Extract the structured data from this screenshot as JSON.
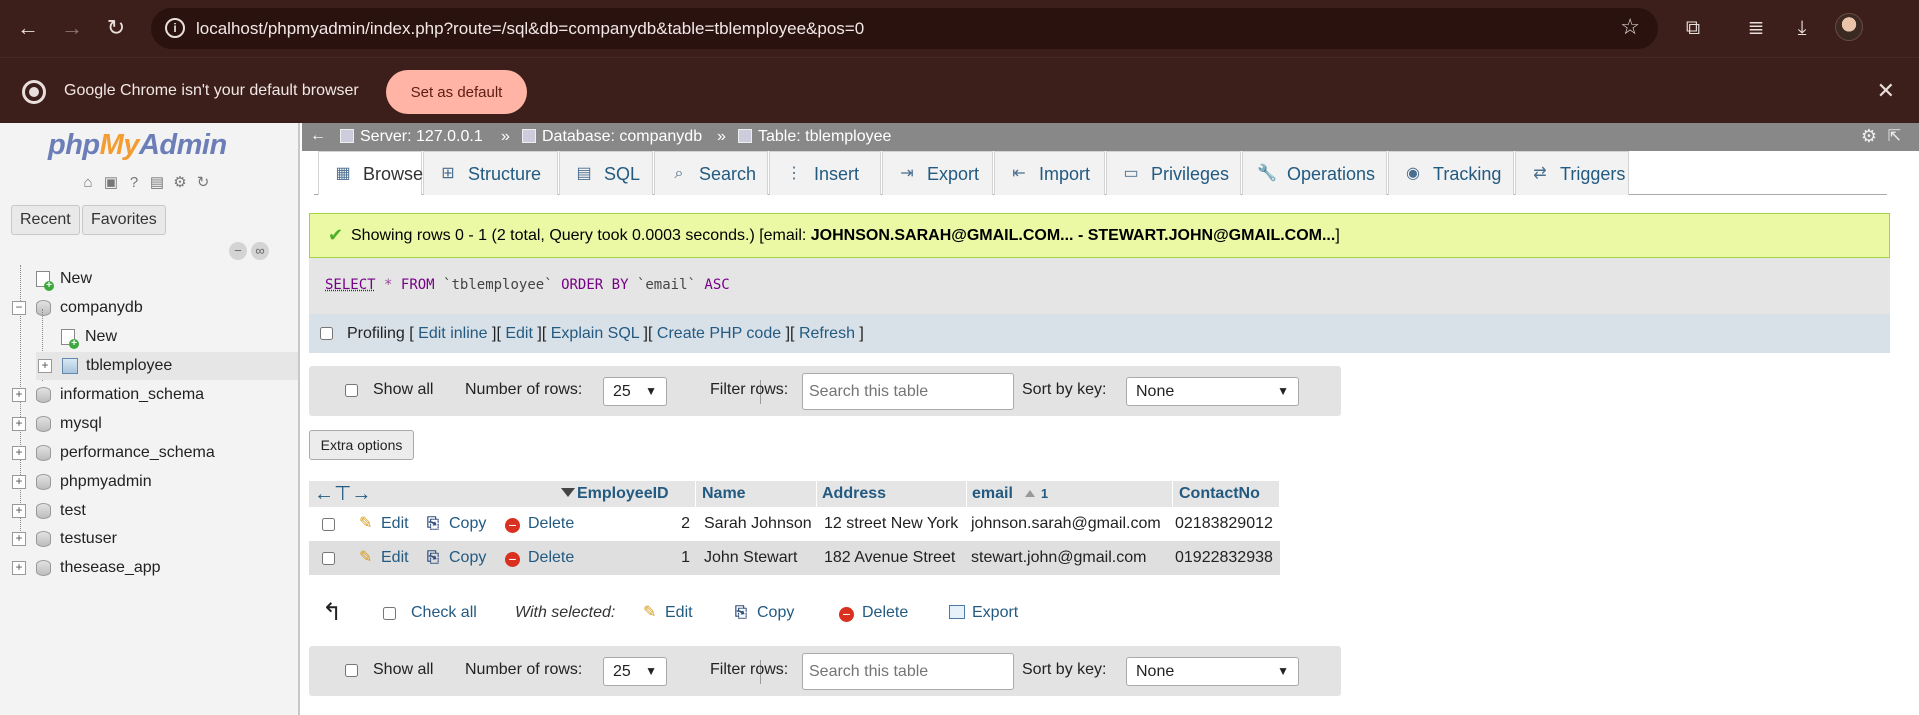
{
  "browser": {
    "url": "localhost/phpmyadmin/index.php?route=/sql&db=companydb&table=tblemployee&pos=0",
    "infobar_text": "Google Chrome isn't your default browser",
    "set_default_label": "Set as default"
  },
  "sidebar": {
    "logo": {
      "php": "php",
      "my": "My",
      "admin": "Admin"
    },
    "recent_label": "Recent",
    "favorites_label": "Favorites",
    "tree": [
      {
        "label": "New"
      },
      {
        "label": "companydb"
      },
      {
        "label": "New"
      },
      {
        "label": "tblemployee"
      },
      {
        "label": "information_schema"
      },
      {
        "label": "mysql"
      },
      {
        "label": "performance_schema"
      },
      {
        "label": "phpmyadmin"
      },
      {
        "label": "test"
      },
      {
        "label": "testuser"
      },
      {
        "label": "thesease_app"
      }
    ]
  },
  "breadcrumb": {
    "server": "Server: 127.0.0.1",
    "database": "Database: companydb",
    "table": "Table: tblemployee",
    "sep": "»"
  },
  "tabs": [
    {
      "label": "Browse"
    },
    {
      "label": "Structure"
    },
    {
      "label": "SQL"
    },
    {
      "label": "Search"
    },
    {
      "label": "Insert"
    },
    {
      "label": "Export"
    },
    {
      "label": "Import"
    },
    {
      "label": "Privileges"
    },
    {
      "label": "Operations"
    },
    {
      "label": "Tracking"
    },
    {
      "label": "Triggers"
    }
  ],
  "result": {
    "message": "Showing rows 0 - 1 (2 total, Query took 0.0003 seconds.) [email: ",
    "range": "JOHNSON.SARAH@GMAIL.COM... - STEWART.JOHN@GMAIL.COM...",
    "message_end": "]"
  },
  "sql": {
    "select": "SELECT",
    "star": "*",
    "from": "FROM",
    "table": "`tblemployee`",
    "order_by": "ORDER BY",
    "column": "`email`",
    "asc": "ASC"
  },
  "profiling": {
    "label": "Profiling",
    "lb": "[",
    "rb": "]",
    "edit_inline": "Edit inline",
    "edit": "Edit",
    "explain": "Explain SQL",
    "create_php": "Create PHP code",
    "refresh": "Refresh"
  },
  "nav_panel": {
    "show_all": "Show all",
    "rows_label": "Number of rows:",
    "rows_value": "25",
    "filter_label": "Filter rows:",
    "filter_placeholder": "Search this table",
    "sort_label": "Sort by key:",
    "sort_value": "None"
  },
  "extra_options_label": "Extra options",
  "table": {
    "columns": [
      "EmployeeID",
      "Name",
      "Address",
      "email",
      "ContactNo"
    ],
    "sort_index": "1",
    "rows": [
      {
        "id": "2",
        "name": "Sarah Johnson",
        "address": "12 street New York",
        "email": "johnson.sarah@gmail.com",
        "contact": "02183829012"
      },
      {
        "id": "1",
        "name": "John Stewart",
        "address": "182 Avenue Street",
        "email": "stewart.john@gmail.com",
        "contact": "01922832938"
      }
    ],
    "actions": {
      "edit": "Edit",
      "copy": "Copy",
      "delete": "Delete"
    }
  },
  "bulk": {
    "check_all": "Check all",
    "with_selected": "With selected:",
    "edit": "Edit",
    "copy": "Copy",
    "delete": "Delete",
    "export": "Export"
  }
}
